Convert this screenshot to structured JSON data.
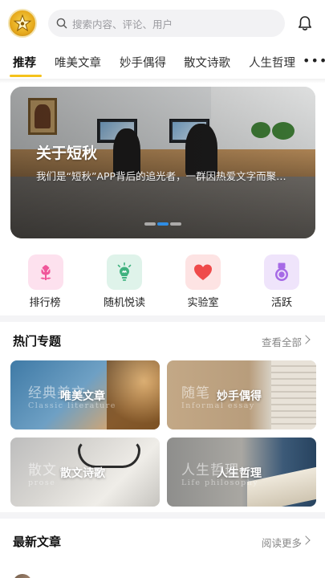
{
  "header": {
    "avatar_icon": "star-logo-icon",
    "search_placeholder": "搜索内容、评论、用户",
    "bell_icon": "bell-icon"
  },
  "tabs": [
    {
      "label": "推荐",
      "active": true
    },
    {
      "label": "唯美文章",
      "active": false
    },
    {
      "label": "妙手偶得",
      "active": false
    },
    {
      "label": "散文诗歌",
      "active": false
    },
    {
      "label": "人生哲理",
      "active": false
    }
  ],
  "tabs_more": "•••",
  "banner": {
    "title": "关于短秋",
    "subtitle": "我们是“短秋”APP背后的追光者，一群因热爱文字而聚集的人",
    "dots": [
      false,
      true,
      false
    ],
    "active_dot_color": "#2f8de4"
  },
  "quick_links": [
    {
      "label": "排行榜",
      "icon": "tulip-icon",
      "bg": "#fde1ee",
      "fg": "#f0569a"
    },
    {
      "label": "随机悦读",
      "icon": "lightbulb-icon",
      "bg": "#dff3ea",
      "fg": "#3fb27f"
    },
    {
      "label": "实验室",
      "icon": "heart-icon",
      "bg": "#fde3e3",
      "fg": "#ef4a4a"
    },
    {
      "label": "活跃",
      "icon": "medal-icon",
      "bg": "#efe4fb",
      "fg": "#a66ae6"
    }
  ],
  "hot_topics": {
    "title": "热门专题",
    "more": "查看全部",
    "cards": [
      {
        "bg_title": "经典美文",
        "bg_sub": "Classic literature",
        "title": "唯美文章"
      },
      {
        "bg_title": "随笔",
        "bg_sub": "Informal essay",
        "title": "妙手偶得"
      },
      {
        "bg_title": "散文",
        "bg_sub": "prose",
        "title": "散文诗歌"
      },
      {
        "bg_title": "人生哲理",
        "bg_sub": "Life philosophy",
        "title": "人生哲理"
      }
    ]
  },
  "latest": {
    "title": "最新文章",
    "more": "阅读更多"
  },
  "colors": {
    "accent": "#f5c21b",
    "divider": "#f4f4f6"
  }
}
